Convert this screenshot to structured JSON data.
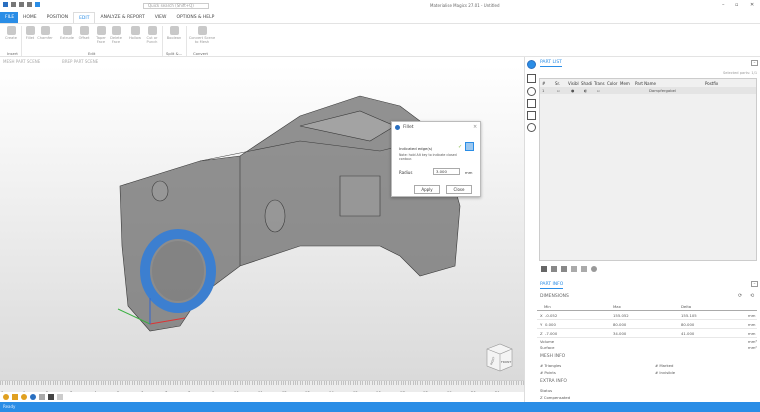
{
  "window": {
    "title": "Materialise Magics 27.01 - Untitled",
    "minimize": "–",
    "maximize": "▫",
    "close": "✕"
  },
  "quick_search": {
    "placeholder": "Quick search (Shift+Q)"
  },
  "menu_tabs": [
    "FILE",
    "HOME",
    "POSITION",
    "EDIT",
    "ANALYZE & REPORT",
    "VIEW",
    "OPTIONS & HELP"
  ],
  "active_tab": "EDIT",
  "ribbon": {
    "buttons": [
      "Create",
      "Fillet",
      "Chamfer",
      "Extrude",
      "Offset",
      "Taper Face",
      "Delete Face",
      "Hollow",
      "Cut or Punch",
      "Boolean",
      "Convert Scene to Mesh"
    ],
    "groups": [
      "Insert",
      "Edit",
      "Split &...",
      "Convert"
    ]
  },
  "scene_tabs": [
    "MESH PART SCENE",
    "BREP PART SCENE"
  ],
  "dialog": {
    "title": "Fillet",
    "indicated_label": "Indicated edge(s)",
    "note": "Note: hold Alt key to indicate closed contour.",
    "radius_label": "Radius",
    "radius_value": "3.000",
    "unit": "mm",
    "apply": "Apply",
    "close": "Close"
  },
  "ruler": {
    "ticks": [
      "0",
      "1",
      "2",
      "3",
      "4",
      "5",
      "6",
      "7",
      "8",
      "9",
      "10",
      "11",
      "12",
      "13",
      "14",
      "15",
      "16",
      "17",
      "18",
      "19",
      "20",
      "21"
    ],
    "unit": "cm"
  },
  "viewcube": {
    "face": "FRONT",
    "side": "RIGHT"
  },
  "part_list": {
    "title": "PART LIST",
    "selected": "Selected parts: 1/1",
    "columns": [
      "#",
      "Sr.",
      "Visibl",
      "Shadi",
      "Trans",
      "Color",
      "Mem",
      "Part Name",
      "Postfix"
    ],
    "rows": [
      {
        "num": "1",
        "name": "Dampfergabel"
      }
    ]
  },
  "part_info": {
    "title": "PART INFO",
    "dimensions_label": "DIMENSIONS",
    "columns": [
      "Min",
      "Max",
      "Delta"
    ],
    "rows": [
      {
        "axis": "X",
        "min": "-0.052",
        "max": "155.052",
        "delta": "155.105",
        "unit": "mm"
      },
      {
        "axis": "Y",
        "min": "0.000",
        "max": "80.000",
        "delta": "80.000",
        "unit": "mm"
      },
      {
        "axis": "Z",
        "min": "-7.000",
        "max": "34.000",
        "delta": "41.000",
        "unit": "mm"
      }
    ],
    "volume_label": "Volume",
    "volume_unit": "mm³",
    "surface_label": "Surface",
    "surface_unit": "mm²",
    "mesh_info_label": "MESH INFO",
    "triangles": "# Triangles",
    "points": "# Points",
    "marked": "# Marked",
    "invisible": "# Invisible",
    "extra_info_label": "EXTRA INFO",
    "status": "Status",
    "z_comp": "Z Compensated"
  },
  "status_bar": "Ready",
  "colors": {
    "accent": "#2a8de6",
    "part": "#6d6d6d",
    "selection": "#3c7fd0"
  }
}
